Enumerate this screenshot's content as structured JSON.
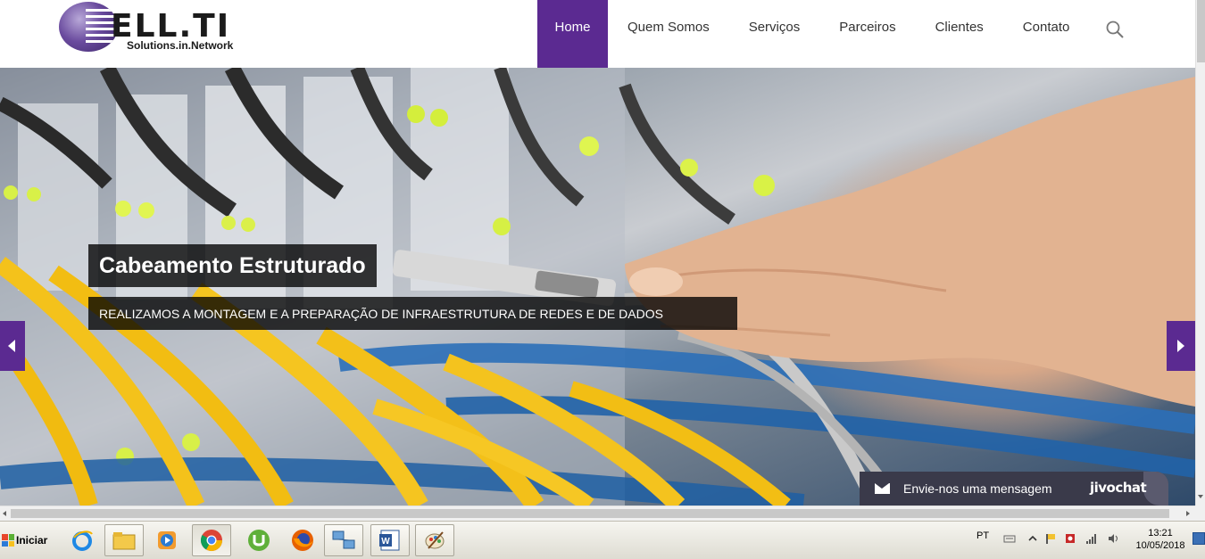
{
  "header": {
    "logo": {
      "main_text": "ELL.TI",
      "sub_text": "Solutions.in.Network"
    },
    "nav": [
      {
        "label": "Home",
        "active": true
      },
      {
        "label": "Quem Somos",
        "active": false
      },
      {
        "label": "Serviços",
        "active": false
      },
      {
        "label": "Parceiros",
        "active": false
      },
      {
        "label": "Clientes",
        "active": false
      },
      {
        "label": "Contato",
        "active": false
      }
    ],
    "search_icon": "search-icon"
  },
  "hero": {
    "title": "Cabeamento Estruturado",
    "subtitle": "REALIZAMOS A MONTAGEM E A PREPARAÇÃO DE INFRAESTRUTURA DE REDES E DE DADOS",
    "prev_icon": "chevron-left-icon",
    "next_icon": "chevron-right-icon"
  },
  "chat": {
    "icon": "envelope-icon",
    "label": "Envie-nos uma mensagem",
    "brand": "jivochat"
  },
  "taskbar": {
    "start_label": "Iniciar",
    "apps": [
      "internet-explorer-icon",
      "file-explorer-icon",
      "media-player-icon",
      "chrome-icon",
      "utorrent-icon",
      "firefox-icon",
      "network-app-icon",
      "word-icon",
      "paint-icon"
    ],
    "language": "PT",
    "time": "13:21",
    "date": "10/05/2018"
  },
  "colors": {
    "brand_purple": "#5b2a91",
    "caption_bg": "#000000",
    "chat_bg": "#3a3a4a"
  }
}
